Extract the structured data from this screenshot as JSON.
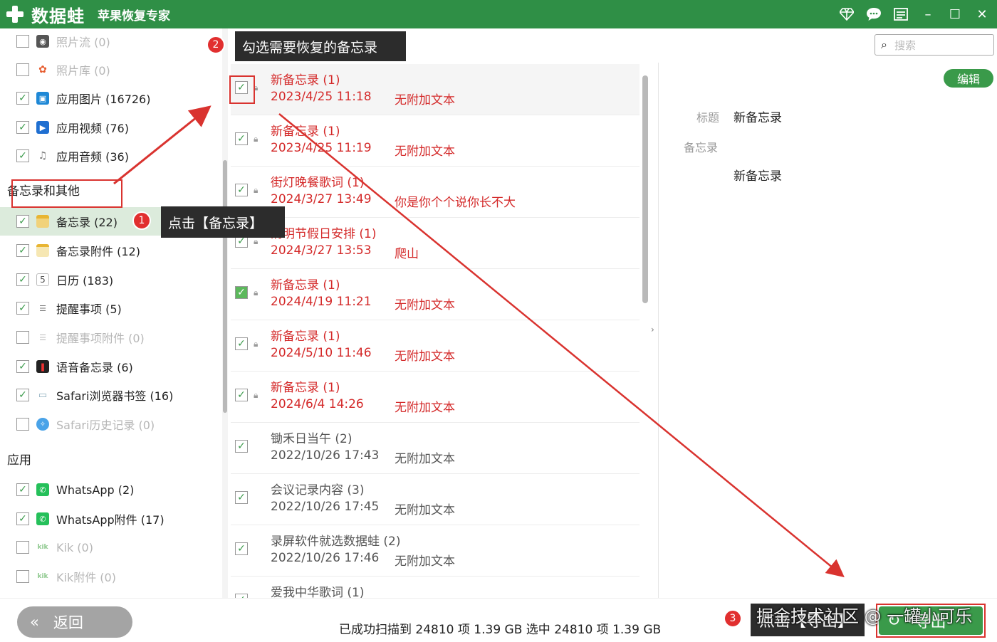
{
  "app": {
    "name": "数据蛙",
    "subtitle": "苹果恢复专家",
    "controls": {
      "diamond": "diamond-icon",
      "chat": "chat-icon",
      "menu": "menu-icon",
      "minimize": "–",
      "maximize": "☐",
      "close": "✕"
    }
  },
  "sidebar": {
    "items_top": [
      {
        "label": "照片流 (0)",
        "checked": false,
        "dim": true
      },
      {
        "label": "照片库 (0)",
        "checked": false,
        "dim": true
      },
      {
        "label": "应用图片 (16726)",
        "checked": true,
        "dim": false
      },
      {
        "label": "应用视频 (76)",
        "checked": true,
        "dim": false
      },
      {
        "label": "应用音频 (36)",
        "checked": true,
        "dim": false
      }
    ],
    "section_notes": "备忘录和其他",
    "items_notes": [
      {
        "label": "备忘录 (22)",
        "checked": true,
        "dim": false
      },
      {
        "label": "备忘录附件 (12)",
        "checked": true,
        "dim": false
      },
      {
        "label": "日历 (183)",
        "checked": true,
        "dim": false
      },
      {
        "label": "提醒事项 (5)",
        "checked": true,
        "dim": false
      },
      {
        "label": "提醒事项附件 (0)",
        "checked": false,
        "dim": true
      },
      {
        "label": "语音备忘录 (6)",
        "checked": true,
        "dim": false
      },
      {
        "label": "Safari浏览器书签 (16)",
        "checked": true,
        "dim": false
      },
      {
        "label": "Safari历史记录 (0)",
        "checked": false,
        "dim": true
      }
    ],
    "section_apps": "应用",
    "items_apps": [
      {
        "label": "WhatsApp (2)",
        "checked": true,
        "dim": false
      },
      {
        "label": "WhatsApp附件 (17)",
        "checked": true,
        "dim": false
      },
      {
        "label": "Kik (0)",
        "checked": false,
        "dim": true
      },
      {
        "label": "Kik附件 (0)",
        "checked": false,
        "dim": true
      }
    ]
  },
  "toolbar": {
    "hint": "勾选需要恢复的备忘录"
  },
  "list": {
    "rows": [
      {
        "title": "新备忘录 (1)",
        "date": "2023/4/25 11:18",
        "attach": "无附加文本",
        "checked": true,
        "red": true,
        "highlight": true
      },
      {
        "title": "新备忘录 (1)",
        "date": "2023/4/25 11:19",
        "attach": "无附加文本",
        "checked": true,
        "red": true,
        "highlight": false
      },
      {
        "title": "街灯晚餐歌词 (1)",
        "date": "2024/3/27 13:49",
        "attach": "你是你个个说你长不大",
        "checked": true,
        "red": true,
        "highlight": false
      },
      {
        "title": "清明节假日安排 (1)",
        "date": "2024/3/27 13:53",
        "attach": "爬山",
        "checked": true,
        "red": true,
        "highlight": false
      },
      {
        "title": "新备忘录 (1)",
        "date": "2024/4/19 11:21",
        "attach": "无附加文本",
        "checked": true,
        "red": true,
        "highlight": false
      },
      {
        "title": "新备忘录 (1)",
        "date": "2024/5/10 11:46",
        "attach": "无附加文本",
        "checked": true,
        "red": true,
        "highlight": false
      },
      {
        "title": "新备忘录 (1)",
        "date": "2024/6/4 14:26",
        "attach": "无附加文本",
        "checked": true,
        "red": true,
        "highlight": false
      },
      {
        "title": "锄禾日当午 (2)",
        "date": "2022/10/26 17:43",
        "attach": "无附加文本",
        "checked": true,
        "red": false,
        "highlight": false
      },
      {
        "title": "会议记录内容 (3)",
        "date": "2022/10/26 17:45",
        "attach": "无附加文本",
        "checked": true,
        "red": false,
        "highlight": false
      },
      {
        "title": "录屏软件就选数据蛙 (2)",
        "date": "2022/10/26 17:46",
        "attach": "无附加文本",
        "checked": true,
        "red": false,
        "highlight": false
      },
      {
        "title": "爱我中华歌词 (1)",
        "date": "",
        "attach": "",
        "checked": true,
        "red": false,
        "highlight": false
      }
    ]
  },
  "detail": {
    "search_placeholder": "搜索",
    "edit_label": "编辑",
    "title_label": "标题",
    "title_value": "新备忘录",
    "notes_label": "备忘录",
    "notes_value": "新备忘录"
  },
  "footer": {
    "back_label": "返回",
    "status": "已成功扫描到 24810 项 1.39 GB  选中 24810 项 1.39 GB",
    "export_label": "导出",
    "export_tip": "点击【导出】",
    "watermark": "掘金技术社区 @ 一罐小可乐"
  },
  "annotations": {
    "step1_badge": "1",
    "step1_tip": "点击【备忘录】",
    "step2_badge": "2",
    "step3_badge": "3"
  },
  "colors": {
    "brand_green": "#2f8f46",
    "button_green": "#3a9a4a",
    "annotation_red": "#d9332f"
  }
}
